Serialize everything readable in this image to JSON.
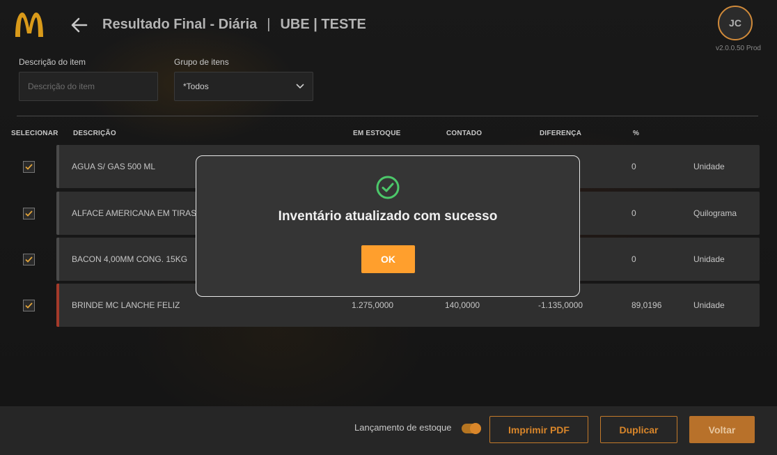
{
  "header": {
    "title": "Resultado Final - Diária",
    "separator": "|",
    "store": "UBE | TESTE",
    "avatar_initials": "JC",
    "version": "v2.0.0.50 Prod"
  },
  "filters": {
    "description_label": "Descrição do item",
    "description_placeholder": "Descrição do item",
    "group_label": "Grupo de itens",
    "group_value": "*Todos"
  },
  "table": {
    "headers": {
      "select": "SELECIONAR",
      "description": "DESCRIÇÃO",
      "stock": "EM ESTOQUE",
      "counted": "CONTADO",
      "difference": "DIFERENÇA",
      "percent": "%"
    },
    "rows": [
      {
        "description": "AGUA S/ GAS 500 ML",
        "stock": "",
        "counted": "",
        "difference": "",
        "percent": "0",
        "unit": "Unidade",
        "checked": true
      },
      {
        "description": "ALFACE AMERICANA EM TIRAS",
        "stock": "",
        "counted": "",
        "difference": "",
        "percent": "0",
        "unit": "Quilograma",
        "checked": true
      },
      {
        "description": "BACON 4,00MM CONG. 15KG",
        "stock": "",
        "counted": "",
        "difference": "",
        "percent": "0",
        "unit": "Unidade",
        "checked": true
      },
      {
        "description": "BRINDE MC LANCHE FELIZ",
        "stock": "1.275,0000",
        "counted": "140,0000",
        "difference": "-1.135,0000",
        "percent": "89,0196",
        "unit": "Unidade",
        "checked": true
      }
    ]
  },
  "footer": {
    "toggle_label": "Lançamento de estoque",
    "toggle_on": true,
    "print_label": "Imprimir PDF",
    "duplicate_label": "Duplicar",
    "back_label": "Voltar"
  },
  "modal": {
    "message": "Inventário atualizado com sucesso",
    "ok_label": "OK",
    "icon": "check-circle-icon"
  },
  "colors": {
    "accent": "#ff9f2d",
    "brand_yellow": "#f2b21b",
    "success": "#4cc86a",
    "alert": "#a43a2a"
  }
}
